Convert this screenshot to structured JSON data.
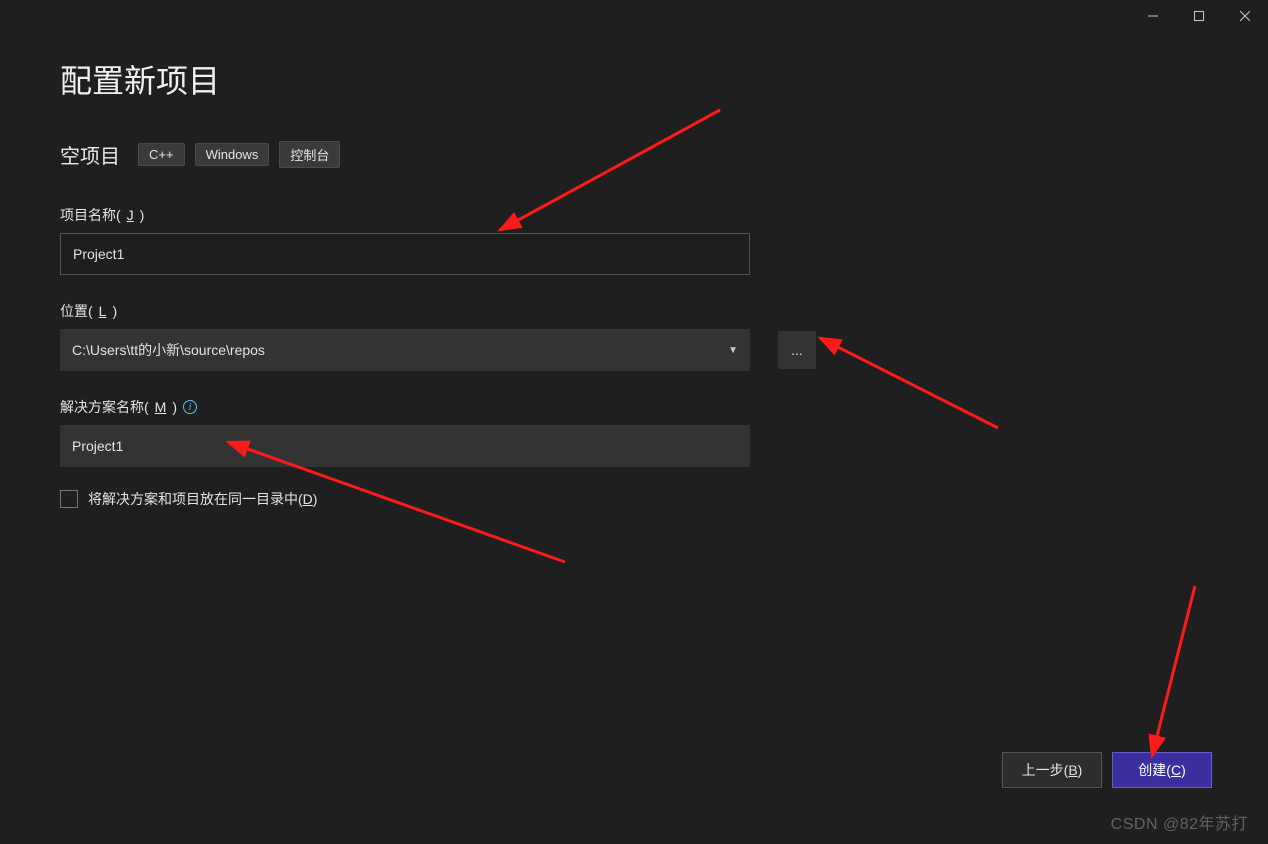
{
  "window": {
    "title": "配置新项目"
  },
  "template": {
    "name": "空项目",
    "tags": [
      "C++",
      "Windows",
      "控制台"
    ]
  },
  "fields": {
    "project_name": {
      "label_prefix": "项目名称(",
      "label_key": "J",
      "label_suffix": ")",
      "value": "Project1"
    },
    "location": {
      "label_prefix": "位置(",
      "label_key": "L",
      "label_suffix": ")",
      "value": "C:\\Users\\tt的小新\\source\\repos",
      "browse": "..."
    },
    "solution_name": {
      "label_prefix": "解决方案名称(",
      "label_key": "M",
      "label_suffix": ")",
      "value": "Project1"
    },
    "same_dir": {
      "label_prefix": "将解决方案和项目放在同一目录中(",
      "label_key": "D",
      "label_suffix": ")"
    }
  },
  "buttons": {
    "back_prefix": "上一步(",
    "back_key": "B",
    "back_suffix": ")",
    "create_prefix": "创建(",
    "create_key": "C",
    "create_suffix": ")"
  },
  "watermark": "CSDN @82年苏打"
}
